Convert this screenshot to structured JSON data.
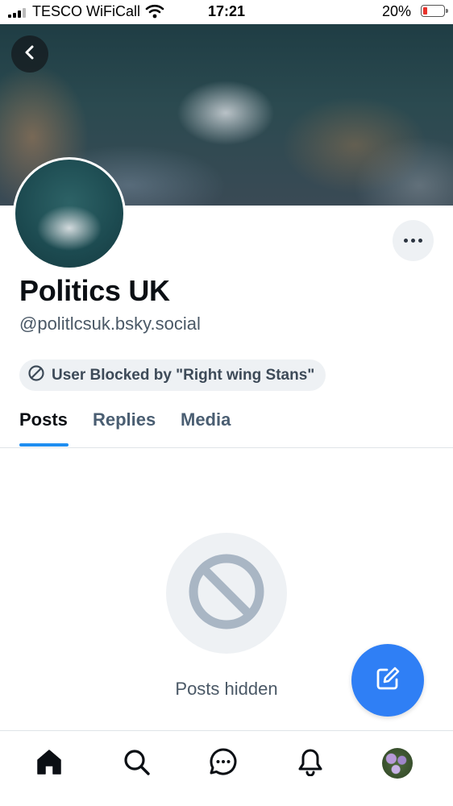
{
  "status_bar": {
    "carrier": "TESCO WiFiCall",
    "time": "17:21",
    "battery": "20%",
    "battery_level": 0.2,
    "icons": [
      "signal-icon",
      "wifi-icon",
      "battery-icon"
    ]
  },
  "header": {
    "back_icon": "chevron-left-icon",
    "more_icon": "ellipsis-icon"
  },
  "profile": {
    "name": "Politics UK",
    "handle": "@politlcsuk.bsky.social",
    "blocked_label": "User Blocked by \"Right wing Stans\"",
    "blocked_icon": "block-icon"
  },
  "tabs": [
    {
      "label": "Posts",
      "active": true
    },
    {
      "label": "Replies",
      "active": false
    },
    {
      "label": "Media",
      "active": false
    }
  ],
  "feed": {
    "empty_icon": "block-icon",
    "empty_text": "Posts hidden"
  },
  "fab": {
    "icon": "compose-icon"
  },
  "bottom_nav": {
    "items": [
      "home-icon",
      "search-icon",
      "chat-icon",
      "notifications-icon",
      "profile-avatar"
    ]
  },
  "colors": {
    "accent": "#1f8ef1",
    "fab": "#2f7ff5",
    "muted_text": "#4a5866",
    "pill_bg": "#eef1f4",
    "battery_low": "#e8322b"
  }
}
